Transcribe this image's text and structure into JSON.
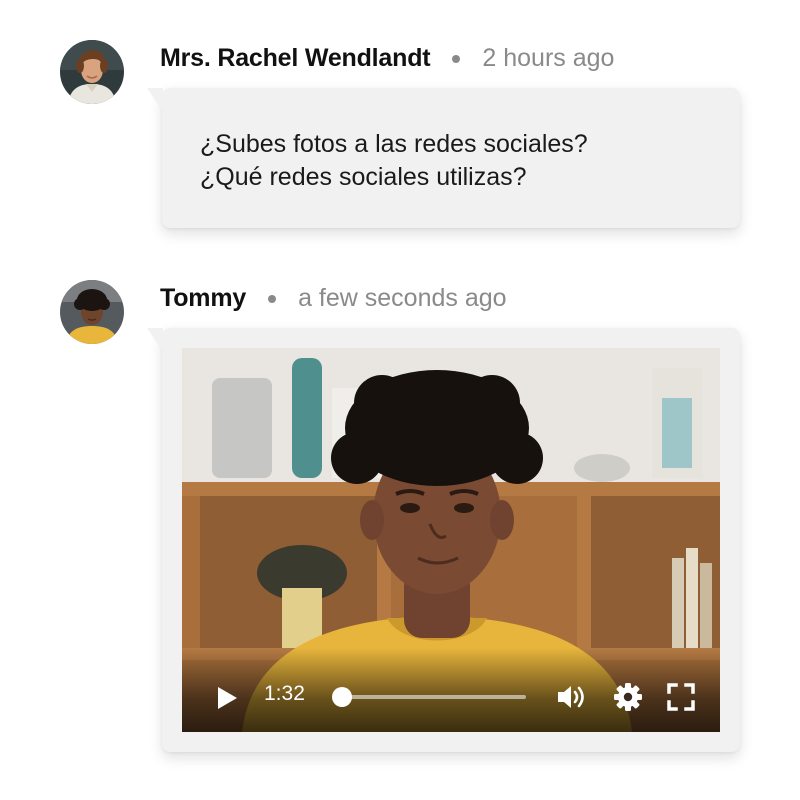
{
  "comments": [
    {
      "author": "Mrs. Rachel Wendlandt",
      "time": "2 hours ago",
      "avatar": "teacher-avatar",
      "message_lines": [
        "¿Subes fotos a las redes sociales?",
        "¿Qué redes sociales utilizas?"
      ]
    },
    {
      "author": "Tommy",
      "time": "a few seconds ago",
      "avatar": "student-avatar",
      "video": {
        "current_time": "1:32",
        "progress": 0.0,
        "controls": [
          "play-icon",
          "volume-icon",
          "gear-icon",
          "fullscreen-icon"
        ]
      }
    }
  ],
  "colors": {
    "bubble": "#f1f1f1",
    "muted_text": "#8a8a8a",
    "author_text": "#111111"
  }
}
